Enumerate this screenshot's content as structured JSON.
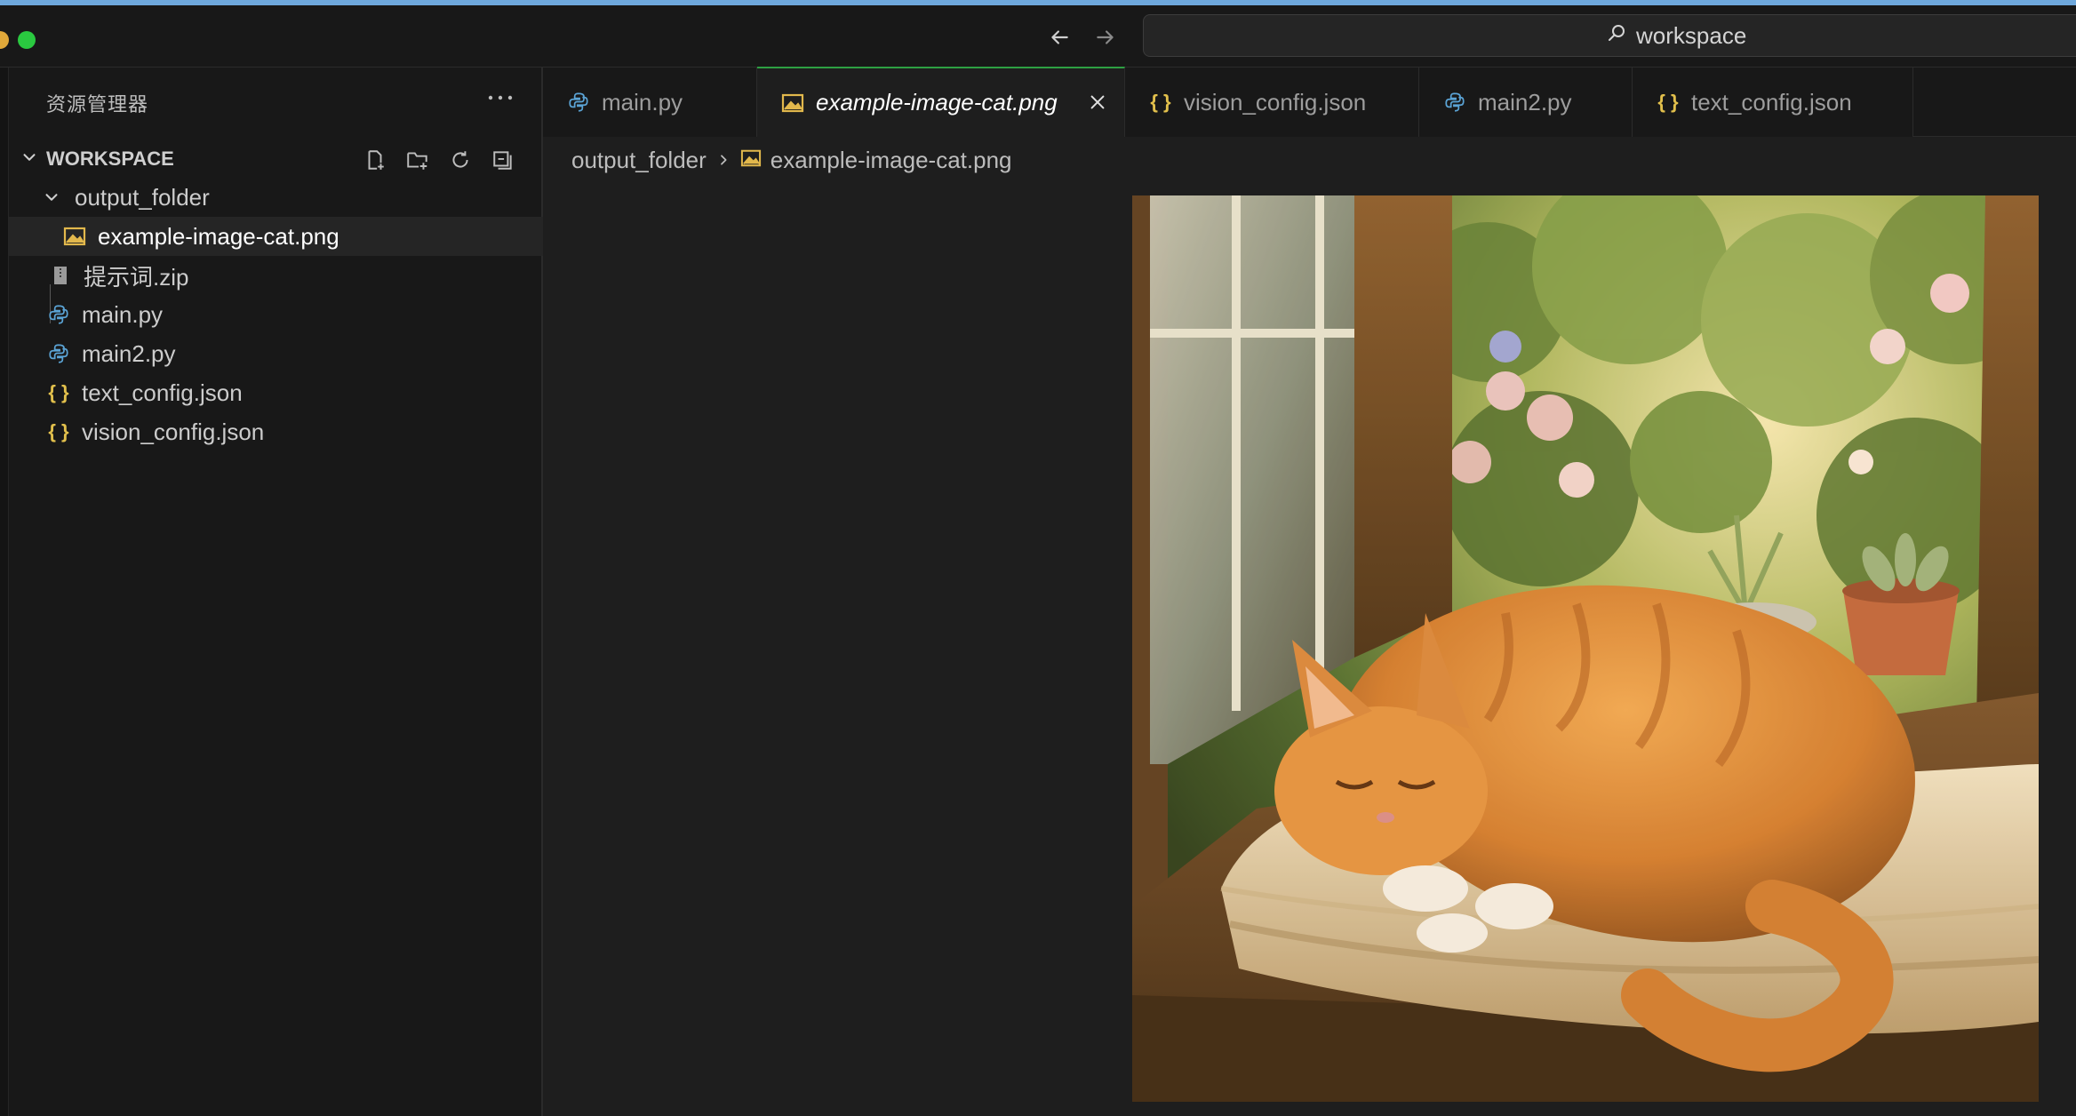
{
  "search": {
    "text": "workspace",
    "icon": "search-icon"
  },
  "sidebar": {
    "title": "资源管理器",
    "more_label": "···",
    "workspace_label": "WORKSPACE",
    "actions": [
      "new-file-icon",
      "new-folder-icon",
      "refresh-icon",
      "collapse-all-icon"
    ],
    "items": [
      {
        "label": "output_folder",
        "type": "folder",
        "icon": "chevron-down-icon"
      },
      {
        "label": "example-image-cat.png",
        "type": "image",
        "icon": "image-icon",
        "selected": true
      },
      {
        "label": "提示词.zip",
        "type": "zip",
        "icon": "zip-icon"
      },
      {
        "label": "main.py",
        "type": "python",
        "icon": "python-icon"
      },
      {
        "label": "main2.py",
        "type": "python",
        "icon": "python-icon"
      },
      {
        "label": "text_config.json",
        "type": "json",
        "icon": "json-icon"
      },
      {
        "label": "vision_config.json",
        "type": "json",
        "icon": "json-icon"
      }
    ]
  },
  "tabs": [
    {
      "label": "main.py",
      "icon": "python-icon"
    },
    {
      "label": "example-image-cat.png",
      "icon": "image-icon",
      "active": true
    },
    {
      "label": "vision_config.json",
      "icon": "json-icon"
    },
    {
      "label": "main2.py",
      "icon": "python-icon"
    },
    {
      "label": "text_config.json",
      "icon": "json-icon"
    }
  ],
  "breadcrumb": {
    "folder": "output_folder",
    "file": "example-image-cat.png"
  },
  "colors": {
    "accent_tab_border": "#2ea043",
    "json_icon": "#e2c04c",
    "python_icon": "#5ba4d6",
    "image_icon": "#e2b84c",
    "selected_row": "#252525"
  }
}
